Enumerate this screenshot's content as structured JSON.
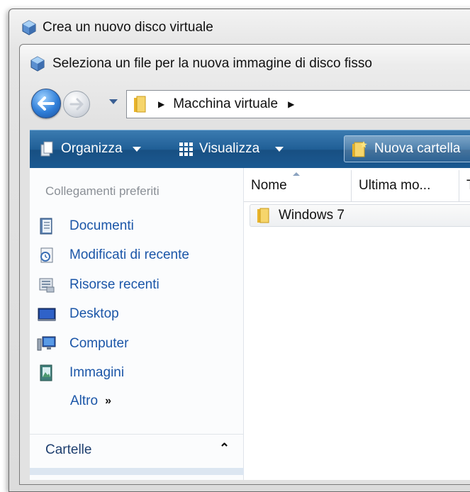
{
  "outer_window": {
    "title": "Crea un nuovo disco virtuale"
  },
  "dialog": {
    "title": "Seleziona un file per la nuova immagine di disco fisso"
  },
  "address_bar": {
    "crumbs": [
      "Macchina virtuale"
    ]
  },
  "toolbar": {
    "organize_label": "Organizza",
    "view_label": "Visualizza",
    "new_folder_label": "Nuova cartella"
  },
  "sidebar": {
    "heading": "Collegamenti preferiti",
    "items": [
      {
        "label": "Documenti",
        "icon": "documents-icon"
      },
      {
        "label": "Modificati di recente",
        "icon": "recent-changes-icon"
      },
      {
        "label": "Risorse recenti",
        "icon": "recent-resources-icon"
      },
      {
        "label": "Desktop",
        "icon": "desktop-icon"
      },
      {
        "label": "Computer",
        "icon": "computer-icon"
      },
      {
        "label": "Immagini",
        "icon": "pictures-icon"
      }
    ],
    "more_label": "Altro",
    "more_glyph": "»",
    "folders_label": "Cartelle",
    "folders_glyph": "⌃"
  },
  "file_list": {
    "columns": [
      "Nome",
      "Ultima mo...",
      "T"
    ],
    "rows": [
      {
        "name": "Windows 7",
        "icon": "folder-icon"
      }
    ]
  },
  "colors": {
    "toolbar": "#1f5e96",
    "link": "#1b56a8",
    "accent_blue": "#2f7ed8"
  }
}
